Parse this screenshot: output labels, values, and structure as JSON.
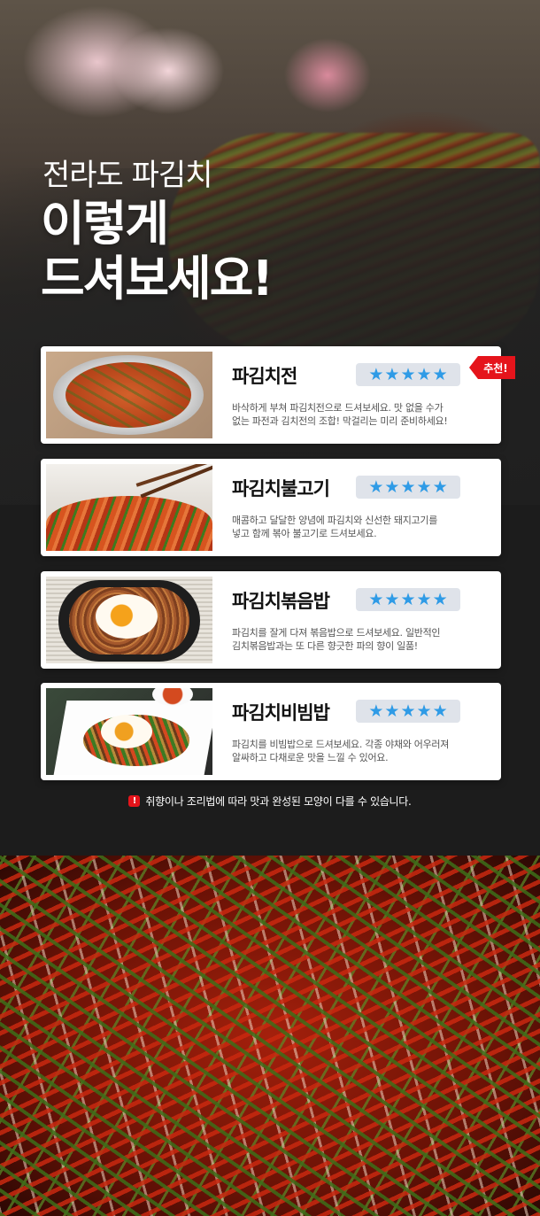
{
  "hero": {
    "subtitle": "전라도 파김치",
    "title_line1": "이렇게",
    "title_line2": "드셔보세요!"
  },
  "badge": {
    "label": "추천!"
  },
  "cards": [
    {
      "title": "파김치전",
      "rating": 5,
      "desc_line1": "바삭하게 부쳐 파김치전으로 드셔보세요. 맛 없을 수가",
      "desc_line2": "없는 파전과 김치전의 조합! 막걸리는 미리 준비하세요!"
    },
    {
      "title": "파김치불고기",
      "rating": 5,
      "desc_line1": "매콤하고 달달한 양념에 파김치와 신선한 돼지고기를",
      "desc_line2": "넣고 함께 볶아 불고기로 드셔보세요."
    },
    {
      "title": "파김치볶음밥",
      "rating": 5,
      "desc_line1": "파김치를 잘게 다져 볶음밥으로 드셔보세요. 일반적인",
      "desc_line2": "김치볶음밥과는 또 다른 향긋한 파의 향이 일품!"
    },
    {
      "title": "파김치비빔밥",
      "rating": 5,
      "desc_line1": "파김치를 비빔밥으로 드셔보세요. 각종 야채와 어우러져",
      "desc_line2": "알싸하고 다채로운 맛을 느낄 수 있어요."
    }
  ],
  "star_glyph": "★",
  "note": {
    "icon": "!",
    "text": "취향이나 조리법에 따라 맛과 완성된 모양이 다를 수 있습니다."
  },
  "colors": {
    "star": "#2f9be6",
    "badge": "#e5141b",
    "background": "#1c1c1c"
  }
}
